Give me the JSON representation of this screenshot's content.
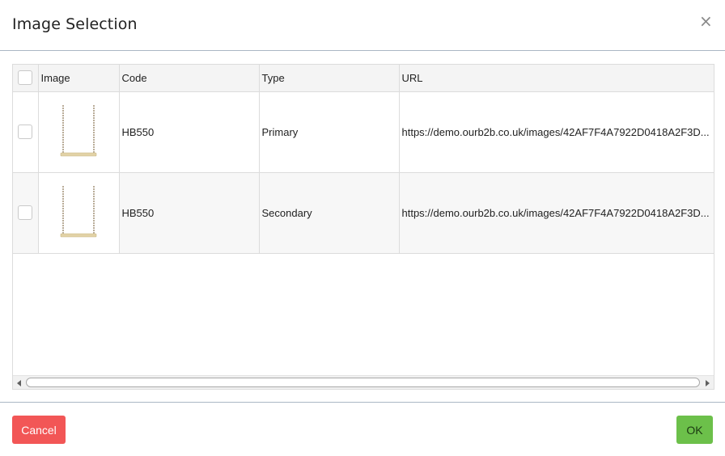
{
  "dialog": {
    "title": "Image Selection",
    "close_glyph": "×",
    "cancel_label": "Cancel",
    "ok_label": "OK"
  },
  "table": {
    "columns": [
      "",
      "Image",
      "Code",
      "Type",
      "URL"
    ],
    "rows": [
      {
        "checked": false,
        "image_icon": "swing-thumbnail",
        "code": "HB550",
        "type": "Primary",
        "url": "https://demo.ourb2b.co.uk/images/42AF7F4A7922D0418A2F3D..."
      },
      {
        "checked": false,
        "image_icon": "swing-thumbnail",
        "code": "HB550",
        "type": "Secondary",
        "url": "https://demo.ourb2b.co.uk/images/42AF7F4A7922D0418A2F3D..."
      }
    ]
  },
  "colors": {
    "cancel": "#f25656",
    "ok": "#6cc04a",
    "divider": "#aab7c4"
  }
}
